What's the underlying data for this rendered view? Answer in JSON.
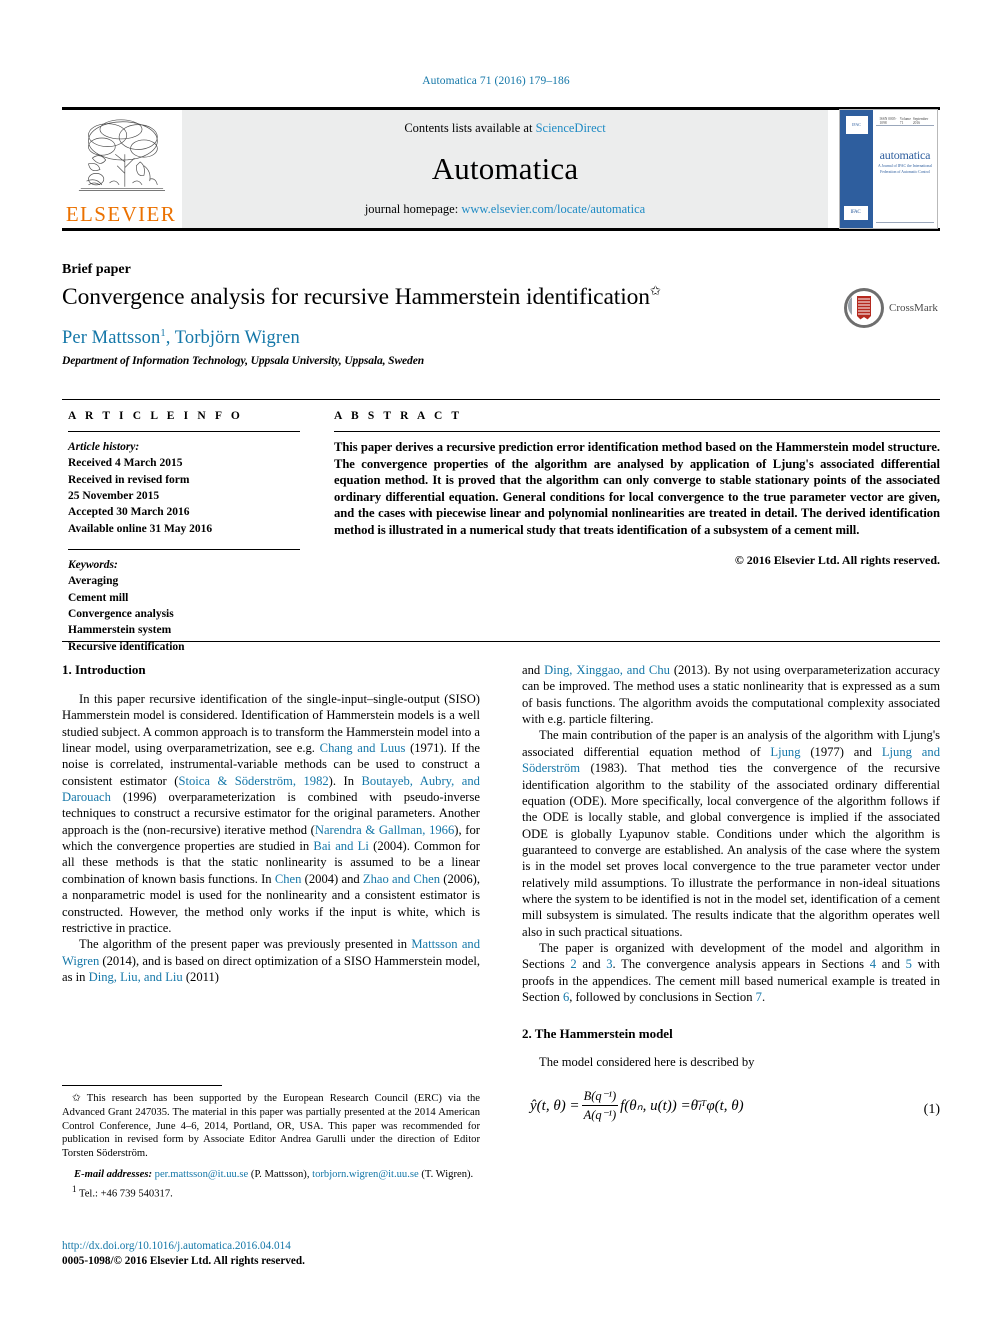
{
  "running_head": "Automatica 71 (2016) 179–186",
  "masthead": {
    "contents_prefix": "Contents lists available at ",
    "contents_link": "ScienceDirect",
    "journal_name": "Automatica",
    "homepage_prefix": "journal homepage: ",
    "homepage_url": "www.elsevier.com/locate/automatica",
    "publisher_logo_text": "ELSEVIER",
    "cover": {
      "title": "automatica",
      "subtitle": "A Journal of IFAC the International Federation of Automatic Control",
      "badge_top": "IFAC",
      "badge_bottom": "IFAC",
      "header_left": "ISSN 0005-1098",
      "header_mid": "Volume 71",
      "header_right": "September 2016"
    }
  },
  "title_block": {
    "article_type": "Brief paper",
    "title": "Convergence analysis for recursive Hammerstein identification",
    "title_footnote_marker": "✩",
    "authors": "Per Mattsson",
    "author_sup": "1",
    "authors_rest": ", Torbjörn Wigren",
    "affiliation": "Department of Information Technology, Uppsala University, Uppsala, Sweden",
    "crossmark_label": "CrossMark"
  },
  "article_info": {
    "heading": "A R T I C L E   I N F O",
    "history_label": "Article history:",
    "history": [
      "Received 4 March 2015",
      "Received in revised form",
      "25 November 2015",
      "Accepted 30 March 2016",
      "Available online 31 May 2016"
    ],
    "keywords_label": "Keywords:",
    "keywords": [
      "Averaging",
      "Cement mill",
      "Convergence analysis",
      "Hammerstein system",
      "Recursive identification"
    ]
  },
  "abstract": {
    "heading": "A B S T R A C T",
    "text": "This paper derives a recursive prediction error identification method based on the Hammerstein model structure. The convergence properties of the algorithm are analysed by application of Ljung's associated differential equation method. It is proved that the algorithm can only converge to stable stationary points of the associated ordinary differential equation. General conditions for local convergence to the true parameter vector are given, and the cases with piecewise linear and polynomial nonlinearities are treated in detail. The derived identification method is illustrated in a numerical study that treats identification of a subsystem of a cement mill.",
    "copyright": "© 2016 Elsevier Ltd. All rights reserved."
  },
  "body": {
    "section1_heading": "1. Introduction",
    "left_para1_a": "In this paper recursive identification of the single-input–single-output (SISO) Hammerstein model is considered. Identification of Hammerstein models is a well studied subject. A common approach is to transform the Hammerstein model into a linear model, using overparametrization, see e.g. ",
    "ref_chang": "Chang and Luus",
    "left_para1_b": " (1971). If the noise is correlated, instrumental-variable methods can be used to construct a consistent estimator (",
    "ref_stoica": "Stoica & Söderström, 1982",
    "left_para1_c": "). In ",
    "ref_boutayeb": "Boutayeb, Aubry, and Darouach",
    "left_para1_d": " (1996) overparameterization is combined with pseudo-inverse techniques to construct a recursive estimator for the original parameters. Another approach is the (non-recursive) iterative method (",
    "ref_narendra": "Narendra & Gallman, 1966",
    "left_para1_e": "), for which the convergence properties are studied in ",
    "ref_bai": "Bai and Li",
    "left_para1_f": " (2004). Common for all these methods is that the static nonlinearity is assumed to be a linear combination of known basis functions. In ",
    "ref_chen": "Chen",
    "left_para1_g": " (2004) and ",
    "ref_zhao": "Zhao and Chen",
    "left_para1_h": " (2006), a nonparametric model is used for the nonlinearity and a consistent estimator is constructed. However, the method only works if the input is white, which is restrictive in practice.",
    "left_para2_a": "The algorithm of the present paper was previously presented in ",
    "ref_mattsson": "Mattsson and Wigren",
    "left_para2_b": " (2014), and is based on direct optimization of a SISO Hammerstein model, as in ",
    "ref_ding_liu": "Ding, Liu, and Liu",
    "left_para2_c": " (2011)",
    "right_para1_a": "and ",
    "ref_ding_xing": "Ding, Xinggao, and Chu",
    "right_para1_b": " (2013). By not using overparameterization accuracy can be improved. The method uses a static nonlinearity that is expressed as a sum of basis functions. The algorithm avoids the computational complexity associated with e.g. particle filtering.",
    "right_para2_a": "The main contribution of the paper is an analysis of the algorithm with Ljung's associated differential equation method of ",
    "ref_ljung": "Ljung",
    "right_para2_b": " (1977) and ",
    "ref_ljung_sod": "Ljung and Söderström",
    "right_para2_c": " (1983). That method ties the convergence of the recursive identification algorithm to the stability of the associated ordinary differential equation (ODE). More specifically, local convergence of the algorithm follows if the ODE is locally stable, and global convergence is implied if the associated ODE is globally Lyapunov stable. Conditions under which the algorithm is guaranteed to converge are established. An analysis of the case where the system is in the model set proves local convergence to the true parameter vector under relatively mild assumptions. To illustrate the performance in non-ideal situations where the system to be identified is not in the model set, identification of a cement mill subsystem is simulated. The results indicate that the algorithm operates well also in such practical situations.",
    "right_para3_a": "The paper is organized with development of the model and algorithm in Sections ",
    "sec_2": "2",
    "right_para3_b": " and ",
    "sec_3": "3",
    "right_para3_c": ". The convergence analysis appears in Sections ",
    "sec_4": "4",
    "right_para3_d": " and ",
    "sec_5": "5",
    "right_para3_e": " with proofs in the appendices. The cement mill based numerical example is treated in Section ",
    "sec_6": "6",
    "right_para3_f": ", followed by conclusions in Section ",
    "sec_7": "7",
    "right_para3_g": ".",
    "section2_heading": "2. The Hammerstein model",
    "right_para4": "The model considered here is described by",
    "equation_number": "(1)",
    "equation": {
      "lhs": "ŷ(t, θ) =",
      "numerator": "B(q⁻¹)",
      "denominator": "A(q⁻¹)",
      "mid": "f(θₙ, u(t)) =",
      "rhs": "θ̄ₗᵀφ(t, θ)"
    }
  },
  "footnotes": {
    "star_marker": "✩",
    "star_text": "This research has been supported by the European Research Council (ERC) via the Advanced Grant 247035. The material in this paper was partially presented at the 2014 American Control Conference, June 4–6, 2014, Portland, OR, USA. This paper was recommended for publication in revised form by Associate Editor Andrea Garulli under the direction of Editor Torsten Söderström.",
    "email_label": "E-mail addresses:",
    "email1": "per.mattsson@it.uu.se",
    "email1_owner": " (P. Mattsson),",
    "email2": "torbjorn.wigren@it.uu.se",
    "email2_owner": " (T. Wigren).",
    "tel_marker": "1",
    "tel_text": "Tel.: +46 739 540317.",
    "doi_url": "http://dx.doi.org/10.1016/j.automatica.2016.04.014",
    "issn_line": "0005-1098/© 2016 Elsevier Ltd. All rights reserved."
  },
  "colors": {
    "link_blue": "#1477a8",
    "sciencedirect_blue": "#1e8ac4",
    "elsevier_orange": "#eb7100",
    "cover_blue": "#2e5e9e",
    "band_grey": "#eceded"
  }
}
